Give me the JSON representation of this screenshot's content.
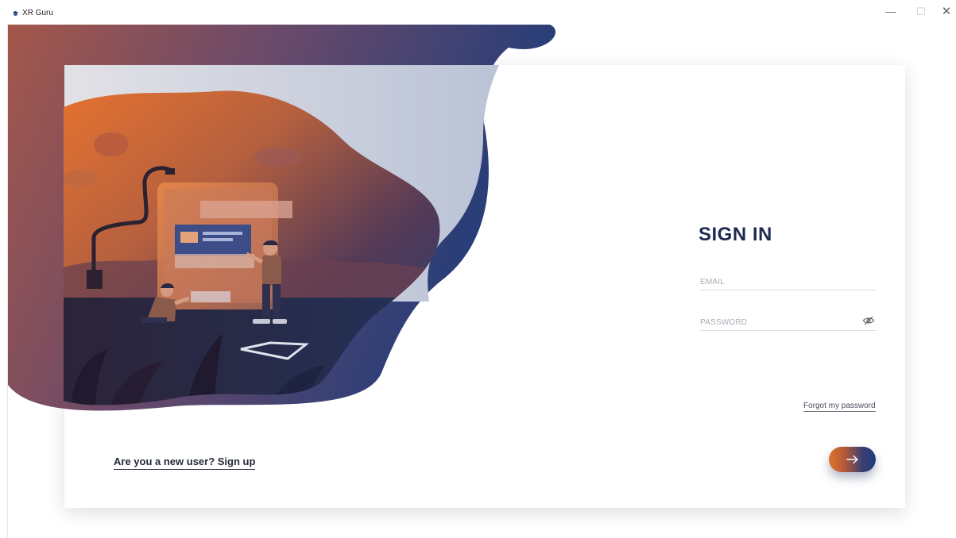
{
  "window": {
    "title": "XR Guru",
    "minimize_glyph": "—",
    "maximize_glyph": "☐",
    "close_glyph": "✕"
  },
  "login": {
    "heading": "SIGN IN",
    "email_placeholder": "EMAIL",
    "password_placeholder": "PASSWORD",
    "forgot_link": "Forgot my password",
    "signup_link": "Are you a new user? Sign up",
    "submit_icon": "arrow-right-icon",
    "password_toggle_icon": "eye-slash-icon"
  },
  "colors": {
    "heading": "#1e2a52",
    "accent_orange": "#e0732c",
    "accent_navy": "#1f3c7a"
  }
}
